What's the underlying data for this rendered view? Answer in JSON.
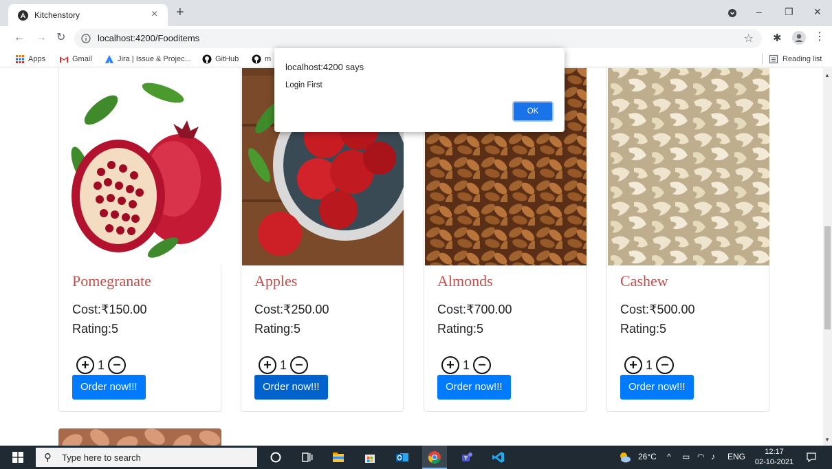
{
  "browser": {
    "tab_title": "Kitchenstory",
    "url": "localhost:4200/Fooditems",
    "bookmarks": [
      {
        "label": "Apps",
        "icon": "apps-grid-icon"
      },
      {
        "label": "Gmail",
        "icon": "gmail-icon"
      },
      {
        "label": "Jira | Issue & Projec...",
        "icon": "jira-icon"
      },
      {
        "label": "GitHub",
        "icon": "github-icon"
      },
      {
        "label": "m",
        "icon": "github-icon"
      }
    ],
    "reading_list": "Reading list"
  },
  "products": [
    {
      "name": "Pomegranate",
      "cost": "Cost:₹150.00",
      "rating": "Rating:5",
      "qty": "1",
      "order": "Order now!!!"
    },
    {
      "name": "Apples",
      "cost": "Cost:₹250.00",
      "rating": "Rating:5",
      "qty": "1",
      "order": "Order now!!!"
    },
    {
      "name": "Almonds",
      "cost": "Cost:₹700.00",
      "rating": "Rating:5",
      "qty": "1",
      "order": "Order now!!!"
    },
    {
      "name": "Cashew",
      "cost": "Cost:₹500.00",
      "rating": "Rating:5",
      "qty": "1",
      "order": "Order now!!!"
    }
  ],
  "alert": {
    "title": "localhost:4200 says",
    "message": "Login First",
    "ok": "OK"
  },
  "taskbar": {
    "search_placeholder": "Type here to search",
    "weather": "26°C",
    "language": "ENG",
    "time": "12:17",
    "date": "02-10-2021"
  },
  "colors": {
    "accent": "#007bff",
    "product_name": "#c0504d",
    "taskbar": "#1f2a33"
  }
}
